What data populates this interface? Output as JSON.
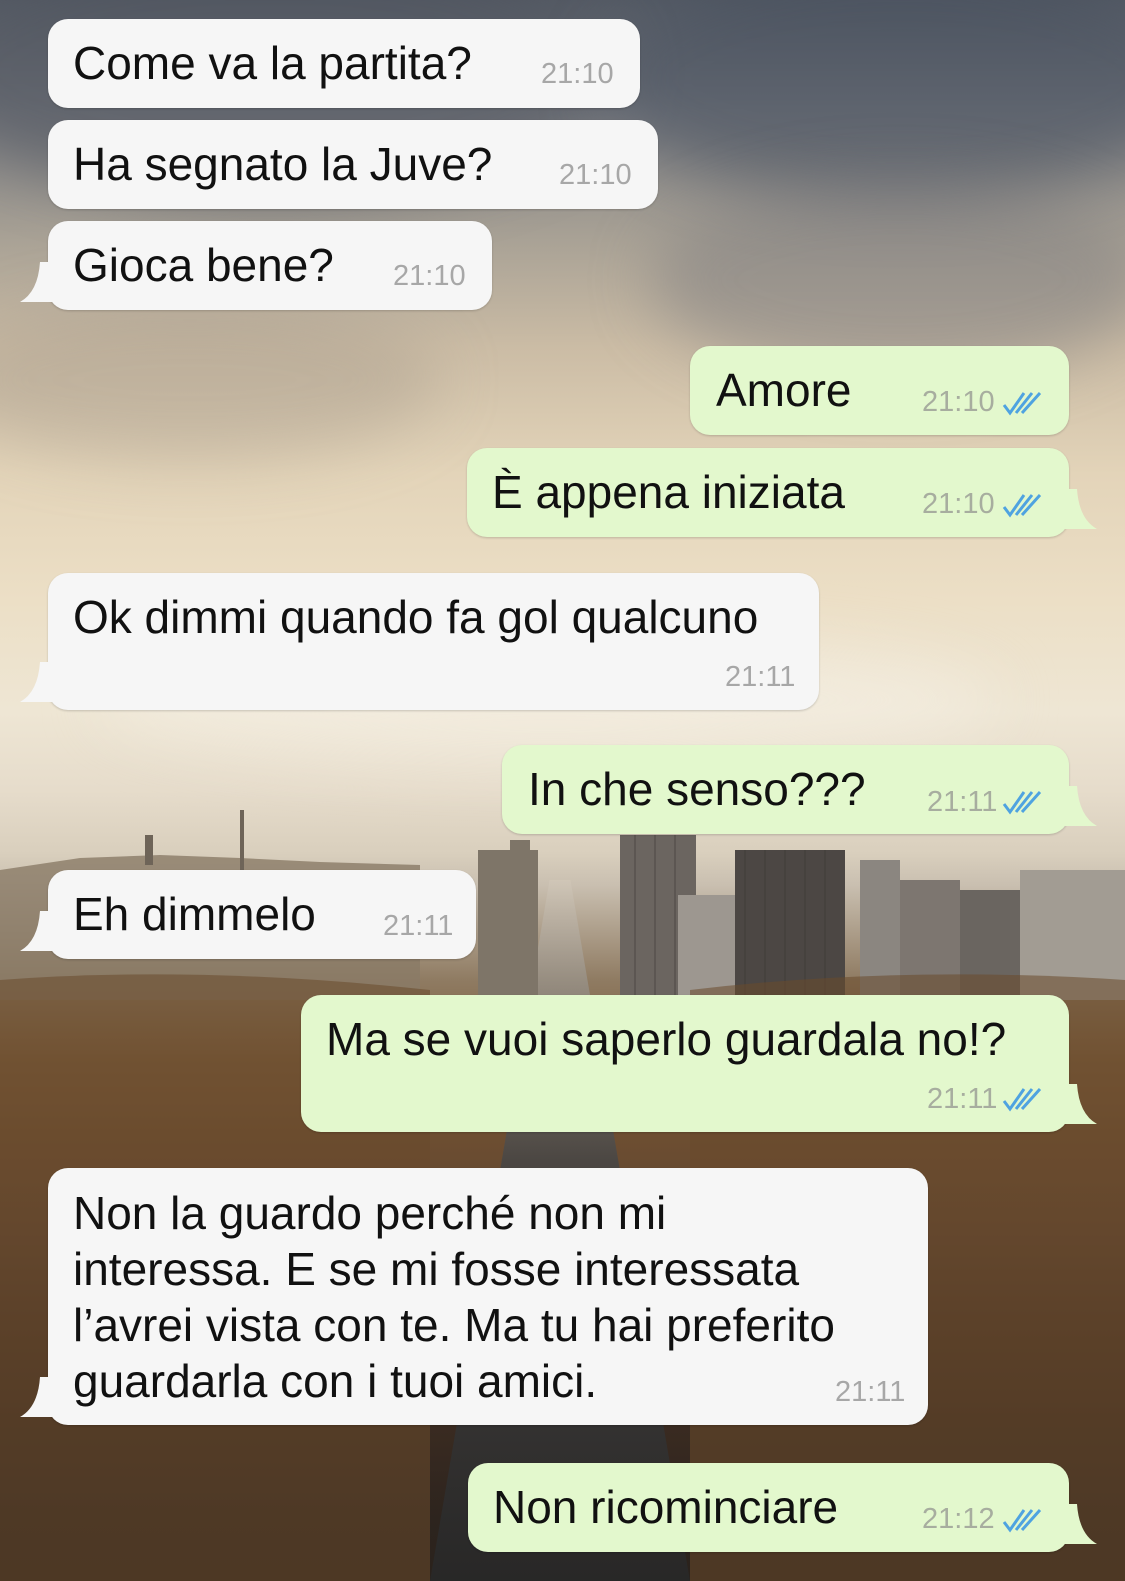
{
  "chat": {
    "messages": [
      {
        "id": "m1",
        "direction": "in",
        "text": "Come va la partita?",
        "time": "21:10"
      },
      {
        "id": "m2",
        "direction": "in",
        "text": "Ha segnato la Juve?",
        "time": "21:10"
      },
      {
        "id": "m3",
        "direction": "in",
        "text": "Gioca bene?",
        "time": "21:10"
      },
      {
        "id": "m4",
        "direction": "out",
        "text": "Amore",
        "time": "21:10",
        "status": "read"
      },
      {
        "id": "m5",
        "direction": "out",
        "text": "È appena iniziata",
        "time": "21:10",
        "status": "read"
      },
      {
        "id": "m6",
        "direction": "in",
        "text": "Ok dimmi quando fa gol qualcuno",
        "time": "21:11"
      },
      {
        "id": "m7",
        "direction": "out",
        "text": "In che senso???",
        "time": "21:11",
        "status": "read"
      },
      {
        "id": "m8",
        "direction": "in",
        "text": "Eh dimmelo",
        "time": "21:11"
      },
      {
        "id": "m9",
        "direction": "out",
        "text": "Ma se vuoi saperlo guardala no!?",
        "time": "21:11",
        "status": "read"
      },
      {
        "id": "m10",
        "direction": "in",
        "text": "Non la guardo perché non mi\ninteressa. E se mi fosse interessata\nl’avrei vista con te. Ma tu hai preferito\nguardarla con i tuoi amici.",
        "time": "21:11"
      },
      {
        "id": "m11",
        "direction": "out",
        "text": "Non ricominciare",
        "time": "21:12",
        "status": "read"
      }
    ]
  },
  "colors": {
    "incoming_bubble": "#f6f6f6",
    "outgoing_bubble": "#e3f8cd",
    "read_ticks": "#4fa3e0",
    "timestamp": "#a7a7a7"
  },
  "icons": {
    "read_receipt": "double-check-icon"
  }
}
